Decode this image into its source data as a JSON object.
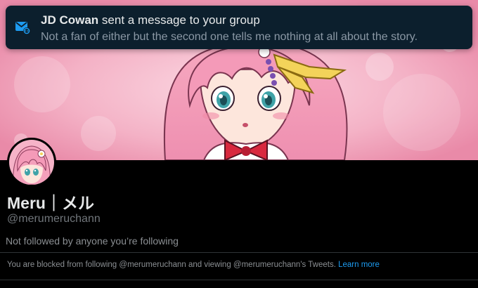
{
  "notification": {
    "sender": "JD Cowan",
    "action": "sent a message to your group",
    "message": "Not a fan of either but the second one tells me nothing at all about the story.",
    "icon": "mail-icon"
  },
  "profile": {
    "display_name": "Meru｜メル",
    "handle": "@merumeruchann",
    "followed_by": "Not followed by anyone you’re following",
    "blocked_notice": "You are blocked from following @merumeruchann and viewing @merumeruchann's Tweets.",
    "learn_more": "Learn more"
  },
  "colors": {
    "toast_bg": "#0c1f2d",
    "link": "#1d9bf0",
    "banner_pink": "#f2a7be",
    "background": "#000000"
  }
}
